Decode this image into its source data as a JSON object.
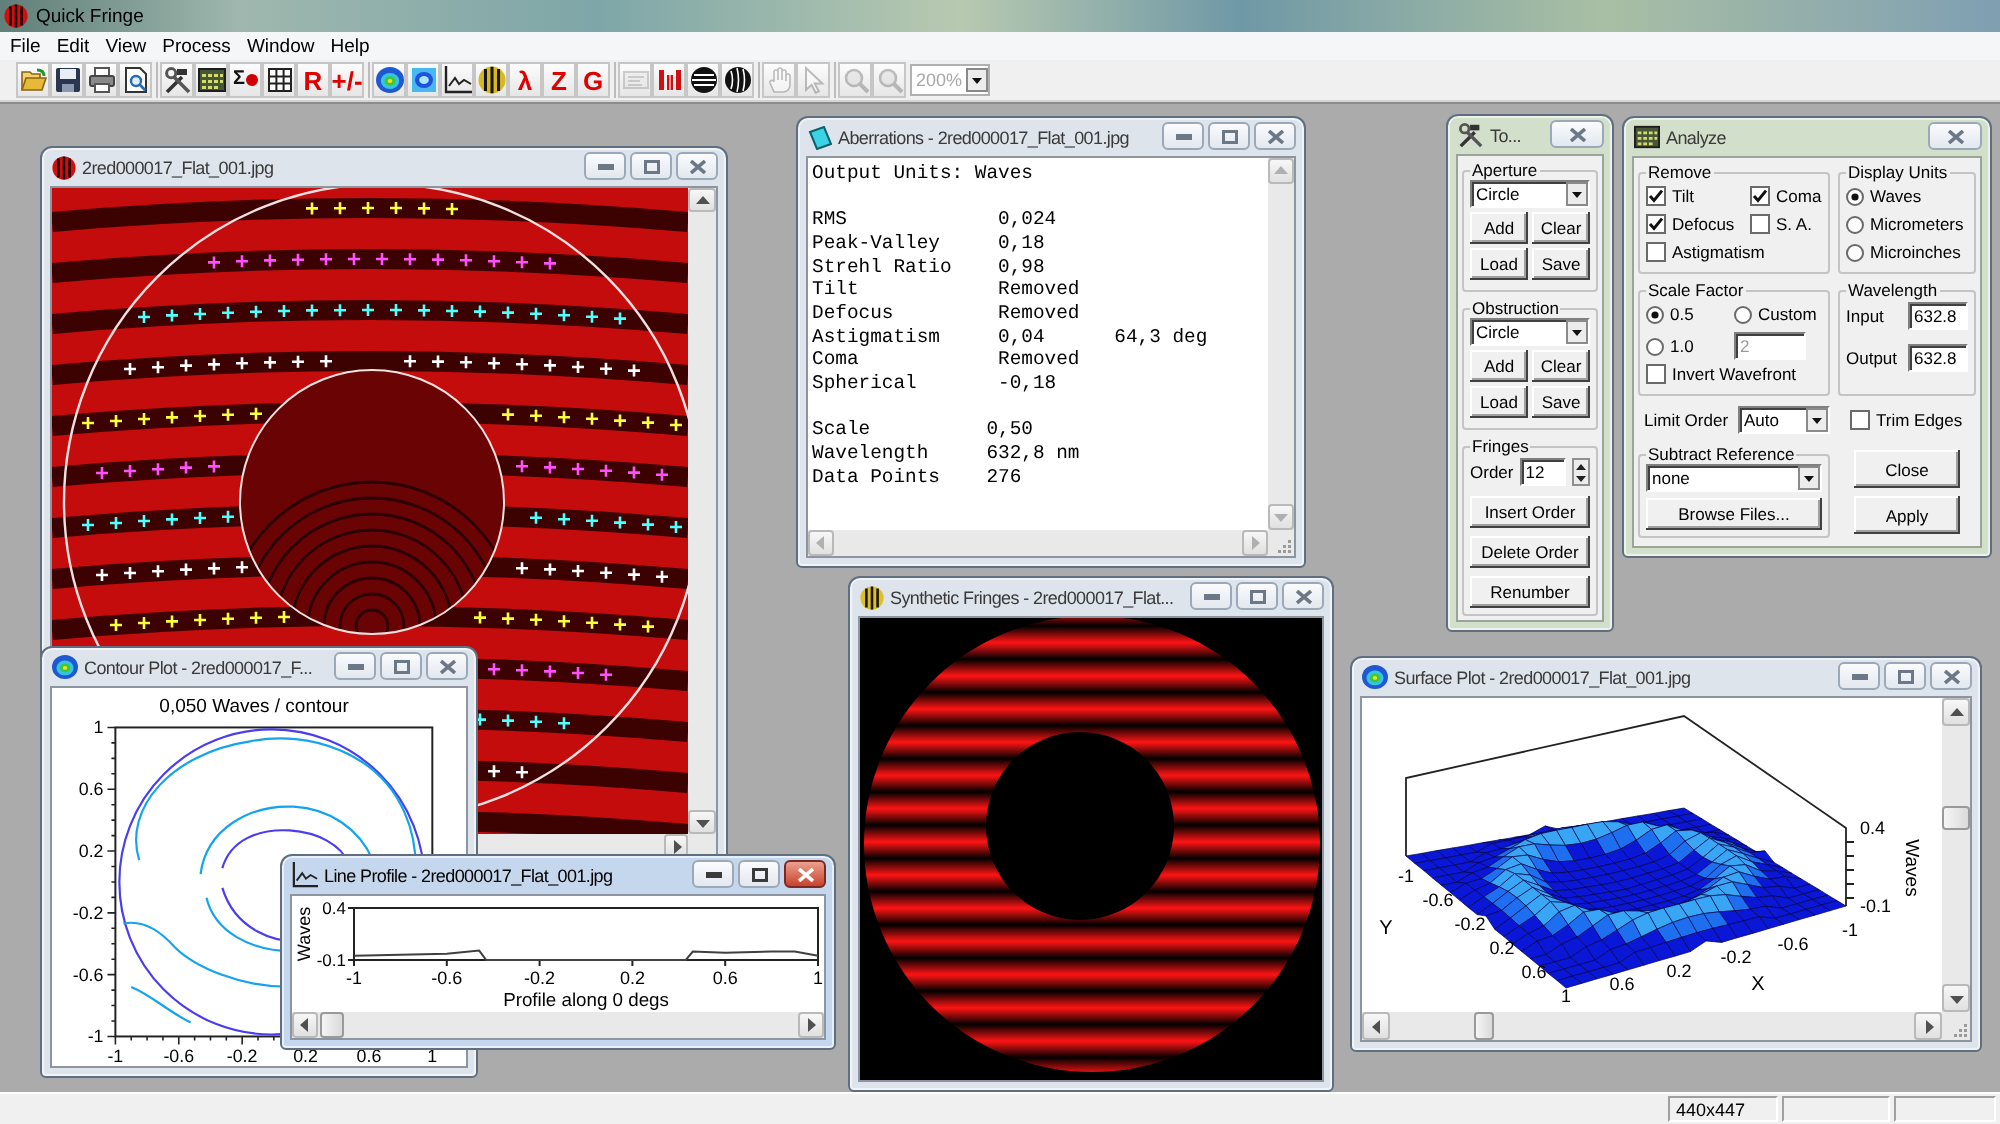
{
  "app": {
    "title": "Quick Fringe"
  },
  "menu": [
    "File",
    "Edit",
    "View",
    "Process",
    "Window",
    "Help"
  ],
  "toolbar": {
    "groups": [
      [
        {
          "kind": "open",
          "disabled": false
        },
        {
          "kind": "save",
          "disabled": false
        },
        {
          "kind": "print",
          "disabled": false
        },
        {
          "kind": "preview",
          "disabled": false
        }
      ],
      [
        {
          "kind": "tools",
          "disabled": false
        },
        {
          "kind": "analyze",
          "disabled": false
        },
        {
          "kind": "sigma",
          "glyph": "Σ",
          "disabled": false
        },
        {
          "kind": "grid",
          "disabled": false
        },
        {
          "kind": "glyph",
          "glyph": "R",
          "disabled": false
        },
        {
          "kind": "glyph",
          "glyph": "+/-",
          "disabled": false
        }
      ],
      [
        {
          "kind": "contour",
          "disabled": false
        },
        {
          "kind": "map",
          "disabled": false
        },
        {
          "kind": "profile",
          "disabled": false
        },
        {
          "kind": "fringe",
          "disabled": false
        },
        {
          "kind": "glyph",
          "glyph": "λ",
          "disabled": false
        },
        {
          "kind": "glyph",
          "glyph": "Z",
          "disabled": false
        },
        {
          "kind": "glyph",
          "glyph": "G",
          "disabled": false
        }
      ],
      [
        {
          "kind": "panel",
          "disabled": true
        },
        {
          "kind": "bars",
          "disabled": false
        },
        {
          "kind": "rings",
          "disabled": false
        },
        {
          "kind": "wave",
          "disabled": false
        }
      ],
      [
        {
          "kind": "hand",
          "disabled": true
        },
        {
          "kind": "pointer",
          "disabled": true
        }
      ],
      [
        {
          "kind": "zoom-in",
          "disabled": true
        },
        {
          "kind": "zoom-out",
          "disabled": true
        }
      ]
    ],
    "zoom": {
      "value": "200%",
      "disabled": true
    }
  },
  "windows": [
    {
      "kind": "image",
      "title": "2red000017_Flat_001.jpg",
      "active": false
    },
    {
      "kind": "report",
      "title": "Aberrations - 2red000017_Flat_001.jpg",
      "active": false,
      "header": "Output Units: Waves",
      "blocks": [
        [
          {
            "label": "RMS",
            "value": "0,024"
          },
          {
            "label": "Peak-Valley",
            "value": "0,18"
          },
          {
            "label": "Strehl Ratio",
            "value": "0,98"
          },
          {
            "label": "Tilt",
            "value": "Removed"
          },
          {
            "label": "Defocus",
            "value": "Removed"
          },
          {
            "label": "Astigmatism",
            "value": "0,04",
            "note": "64,3 deg"
          },
          {
            "label": "Coma",
            "value": "Removed"
          },
          {
            "label": "Spherical",
            "value": "-0,18"
          }
        ],
        [
          {
            "label": "Scale",
            "value": "0,50"
          },
          {
            "label": "Wavelength",
            "value": "632,8 nm"
          },
          {
            "label": "Data Points",
            "value": "276"
          }
        ]
      ]
    },
    {
      "kind": "tools",
      "title": "To...",
      "active": false,
      "groups": [
        {
          "kind": "shape",
          "title": "Aperture",
          "shape": "Circle",
          "buttons": [
            "Add",
            "Clear",
            "Load",
            "Save"
          ]
        },
        {
          "kind": "shape",
          "title": "Obstruction",
          "shape": "Circle",
          "buttons": [
            "Add",
            "Clear",
            "Load",
            "Save"
          ]
        },
        {
          "kind": "fringes",
          "title": "Fringes",
          "order_label": "Order",
          "order": "12",
          "buttons": [
            "Insert Order",
            "Delete Order",
            "Renumber"
          ]
        }
      ]
    },
    {
      "kind": "analyze",
      "title": "Analyze",
      "active": false,
      "remove": {
        "title": "Remove",
        "options": [
          {
            "label": "Tilt",
            "checked": true
          },
          {
            "label": "Coma",
            "checked": true
          },
          {
            "label": "Defocus",
            "checked": true
          },
          {
            "label": "S. A.",
            "checked": false
          },
          {
            "label": "Astigmatism",
            "checked": false
          }
        ]
      },
      "display_units": {
        "title": "Display Units",
        "options": [
          {
            "label": "Waves",
            "selected": true
          },
          {
            "label": "Micrometers",
            "selected": false
          },
          {
            "label": "Microinches",
            "selected": false
          }
        ]
      },
      "scale_factor": {
        "title": "Scale Factor",
        "options": [
          {
            "label": "0.5",
            "selected": true
          },
          {
            "label": "Custom",
            "selected": false
          },
          {
            "label": "1.0",
            "selected": false
          }
        ],
        "custom": {
          "value": "2",
          "disabled": true
        },
        "invert": {
          "label": "Invert Wavefront",
          "checked": false
        }
      },
      "wavelength": {
        "title": "Wavelength",
        "fields": [
          {
            "label": "Input",
            "value": "632.8"
          },
          {
            "label": "Output",
            "value": "632.8"
          }
        ]
      },
      "limit_order": {
        "label": "Limit Order",
        "value": "Auto"
      },
      "trim_edges": {
        "label": "Trim Edges",
        "checked": false
      },
      "subtract_reference": {
        "title": "Subtract Reference",
        "value": "none",
        "button": "Browse Files..."
      },
      "buttons": [
        "Close",
        "Apply"
      ]
    },
    {
      "kind": "fringes",
      "title": "Synthetic Fringes - 2red000017_Flat...",
      "active": false
    },
    {
      "kind": "contour",
      "title": "Contour Plot - 2red000017_F...",
      "active": false,
      "plot_title": "0,050 Waves / contour",
      "yticks": [
        "1",
        "0.6",
        "0.2",
        "-0.2",
        "-0.6",
        "-1"
      ],
      "xticks": [
        "-1",
        "-0.6",
        "-0.2",
        "0.2",
        "0.6",
        "1"
      ]
    },
    {
      "kind": "profile",
      "title": "Line Profile - 2red000017_Flat_001.jpg",
      "active": true,
      "chart_data": {
        "type": "line",
        "xlabel": "Profile along 0 degs",
        "ylabel": "Waves",
        "x": [
          -1,
          -0.8,
          -0.6,
          -0.46,
          -0.43,
          0.43,
          0.46,
          0.6,
          0.8,
          0.9,
          1
        ],
        "series": [
          {
            "color": "#404040",
            "values": [
              -0.06,
              -0.05,
              -0.04,
              -0.01,
              -0.1,
              -0.1,
              -0.02,
              -0.03,
              -0.02,
              -0.02,
              -0.06
            ]
          }
        ],
        "xlim": [
          -1,
          1
        ],
        "ylim": [
          -0.1,
          0.4
        ],
        "xticks": [
          -1,
          -0.6,
          -0.2,
          0.2,
          0.6,
          1
        ],
        "yticks": [
          0.4,
          -0.1
        ]
      }
    },
    {
      "kind": "surface",
      "title": "Surface Plot - 2red000017_Flat_001.jpg",
      "active": false,
      "y_axis": {
        "label": "Y",
        "ticks": [
          "-1",
          "-0.6",
          "-0.2",
          "0.2",
          "0.6",
          "1"
        ]
      },
      "x_axis": {
        "label": "X",
        "ticks": [
          "0.6",
          "0.2",
          "-0.2",
          "-0.6",
          "-1"
        ]
      },
      "z_axis": {
        "label": "Waves",
        "ticks": [
          "0.4",
          "-0.1"
        ]
      }
    }
  ],
  "status_bar": {
    "panes": [
      "440x447"
    ]
  }
}
